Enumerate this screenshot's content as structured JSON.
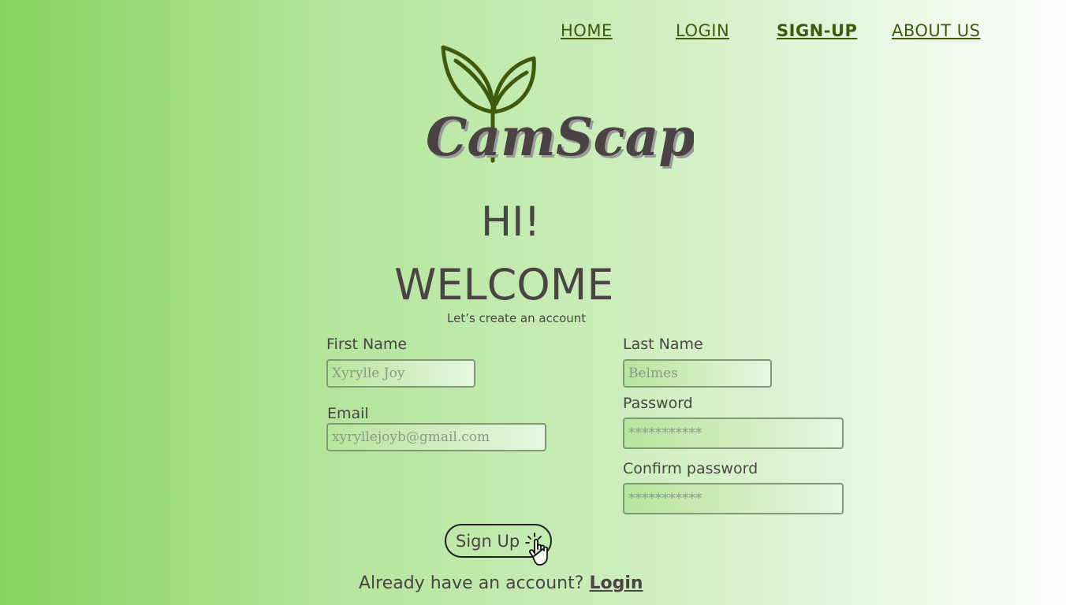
{
  "nav": {
    "items": [
      {
        "label": "HOME"
      },
      {
        "label": "LOGIN"
      },
      {
        "label": "SIGN-UP",
        "active": true
      },
      {
        "label": "ABOUT US"
      }
    ]
  },
  "logo": {
    "text": "CalmScape",
    "part1": "Ca",
    "part2": "mScape"
  },
  "heading": {
    "hi": "HI!",
    "welcome": "WELCOME",
    "subtitle": "Let’s create an account"
  },
  "form": {
    "first_name": {
      "label": "First Name",
      "placeholder": "Xyrylle Joy"
    },
    "last_name": {
      "label": "Last Name",
      "placeholder": "Belmes"
    },
    "email": {
      "label": "Email",
      "placeholder": "xyryllejoyb@gmail.com"
    },
    "password": {
      "label": "Password",
      "placeholder": "***********"
    },
    "confirm_password": {
      "label": "Confirm password",
      "placeholder": "***********"
    },
    "submit_label": "Sign Up"
  },
  "footer": {
    "prompt": "Already have an account?",
    "login_link": "Login"
  },
  "colors": {
    "nav": "#3f5a0c",
    "text": "#4a4444",
    "leaf": "#3f5a0c",
    "bg_left": "#86d45e",
    "bg_right": "#ffffff"
  }
}
